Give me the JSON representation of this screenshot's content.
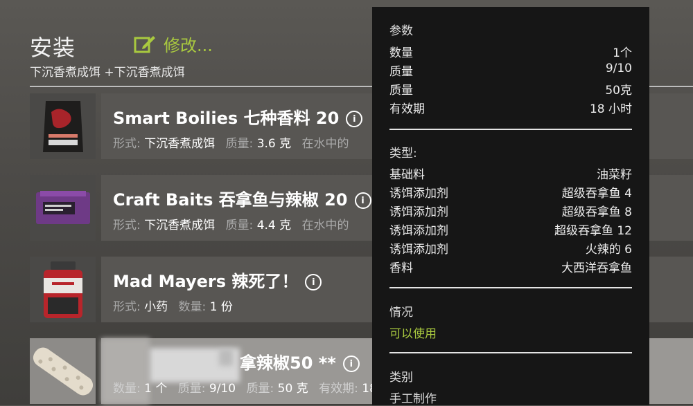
{
  "header": {
    "title": "安装",
    "edit_label": "修改...",
    "subtitle": "下沉香煮成饵 +下沉香煮成饵"
  },
  "items": [
    {
      "name": "Smart Boilies 七种香料 20",
      "meta": [
        {
          "k": "形式:",
          "v": "下沉香煮成饵"
        },
        {
          "k": "质量:",
          "v": "3.6 克"
        },
        {
          "k": "在水中的",
          "v": ""
        }
      ],
      "icon": "bait-bag-icon"
    },
    {
      "name": "Craft Baits 吞拿鱼与辣椒 20",
      "meta": [
        {
          "k": "形式:",
          "v": "下沉香煮成饵"
        },
        {
          "k": "质量:",
          "v": "4.4 克"
        },
        {
          "k": "在水中的",
          "v": ""
        }
      ],
      "icon": "bait-box-icon"
    },
    {
      "name": "Mad Mayers 辣死了！",
      "meta": [
        {
          "k": "形式:",
          "v": "小药"
        },
        {
          "k": "数量:",
          "v": "1 份"
        }
      ],
      "icon": "bait-jar-icon"
    },
    {
      "name": "拿辣椒50 **",
      "meta": [
        {
          "k": "数量:",
          "v": "1 个"
        },
        {
          "k": "质量:",
          "v": "9/10"
        },
        {
          "k": "质量:",
          "v": "50 克"
        },
        {
          "k": "有效期:",
          "v": "18"
        }
      ],
      "icon": "boilie-stick-icon"
    }
  ],
  "panel": {
    "params_title": "参数",
    "params": [
      {
        "k": "数量",
        "v": "1个"
      },
      {
        "k": "质量",
        "v": "9/10"
      },
      {
        "k": "质量",
        "v": "50克"
      },
      {
        "k": "有效期",
        "v": "18 小时"
      }
    ],
    "type_title": "类型:",
    "types": [
      {
        "k": "基础料",
        "v": "油菜籽"
      },
      {
        "k": "诱饵添加剂",
        "v": "超级吞拿鱼 4"
      },
      {
        "k": "诱饵添加剂",
        "v": "超级吞拿鱼 8"
      },
      {
        "k": "诱饵添加剂",
        "v": "超级吞拿鱼 12"
      },
      {
        "k": "诱饵添加剂",
        "v": "火辣的 6"
      },
      {
        "k": "香料",
        "v": "大西洋吞拿鱼"
      }
    ],
    "status_title": "情况",
    "status_value": "可以使用",
    "category_title": "类别",
    "category_value": "手工制作"
  },
  "colors": {
    "accent": "#a9c93f",
    "panel_bg": "#161616",
    "row_bg": "#585653"
  }
}
